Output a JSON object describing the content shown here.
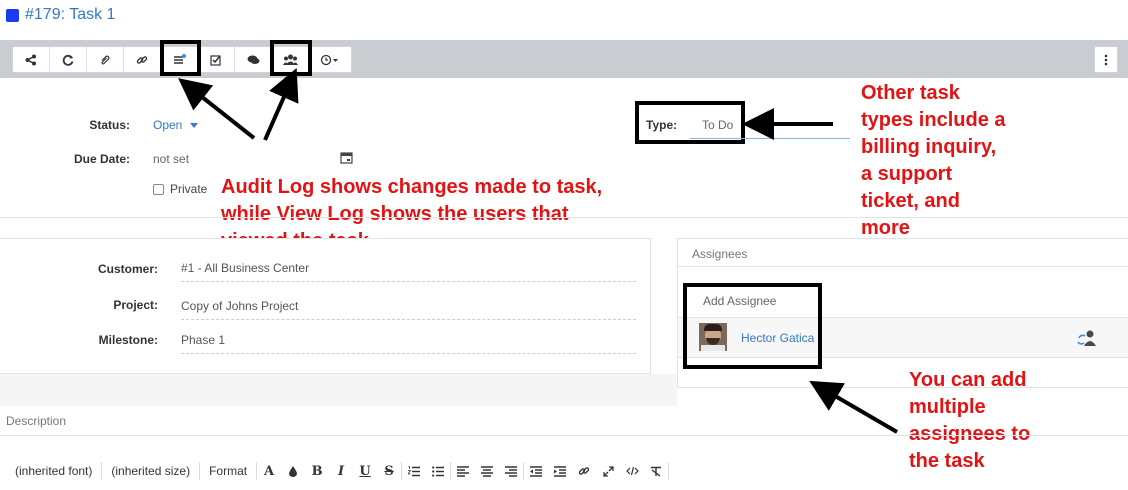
{
  "title": "#179: Task 1",
  "colors": {
    "accent": "#3478c6",
    "title_square": "#1a3cf0",
    "annotation": "#e31313",
    "toolbar_bg": "#c9ccd1"
  },
  "toolbar": {
    "buttons": [
      "share-icon",
      "refresh-icon",
      "paperclip-icon",
      "link-icon",
      "audit-log-icon",
      "checklist-icon",
      "comments-icon",
      "view-log-users-icon",
      "clock-icon"
    ],
    "more": "more-vertical-icon"
  },
  "form": {
    "status_label": "Status:",
    "status_value": "Open",
    "due_label": "Due Date:",
    "due_value": "not set",
    "private_label": "Private",
    "type_label": "Type:",
    "type_value": "To Do"
  },
  "annotations": {
    "log": [
      "Audit Log shows changes made to task,",
      "while View Log shows the users that",
      "viewed the task"
    ],
    "types": [
      "Other task",
      "types include a",
      "billing inquiry,",
      "a support",
      "ticket, and",
      "more"
    ],
    "assignees": [
      "You can add",
      "multiple",
      "assignees to",
      "the task"
    ]
  },
  "details": {
    "customer_label": "Customer:",
    "customer_value": "#1 - All Business Center",
    "project_label": "Project:",
    "project_value": "Copy of Johns Project",
    "milestone_label": "Milestone:",
    "milestone_value": "Phase 1"
  },
  "assignees": {
    "header": "Assignees",
    "add_label": "Add Assignee",
    "people": [
      {
        "name": "Hector Gatica"
      }
    ]
  },
  "description": {
    "label": "Description",
    "font": "(inherited font)",
    "size": "(inherited size)",
    "format": "Format"
  }
}
